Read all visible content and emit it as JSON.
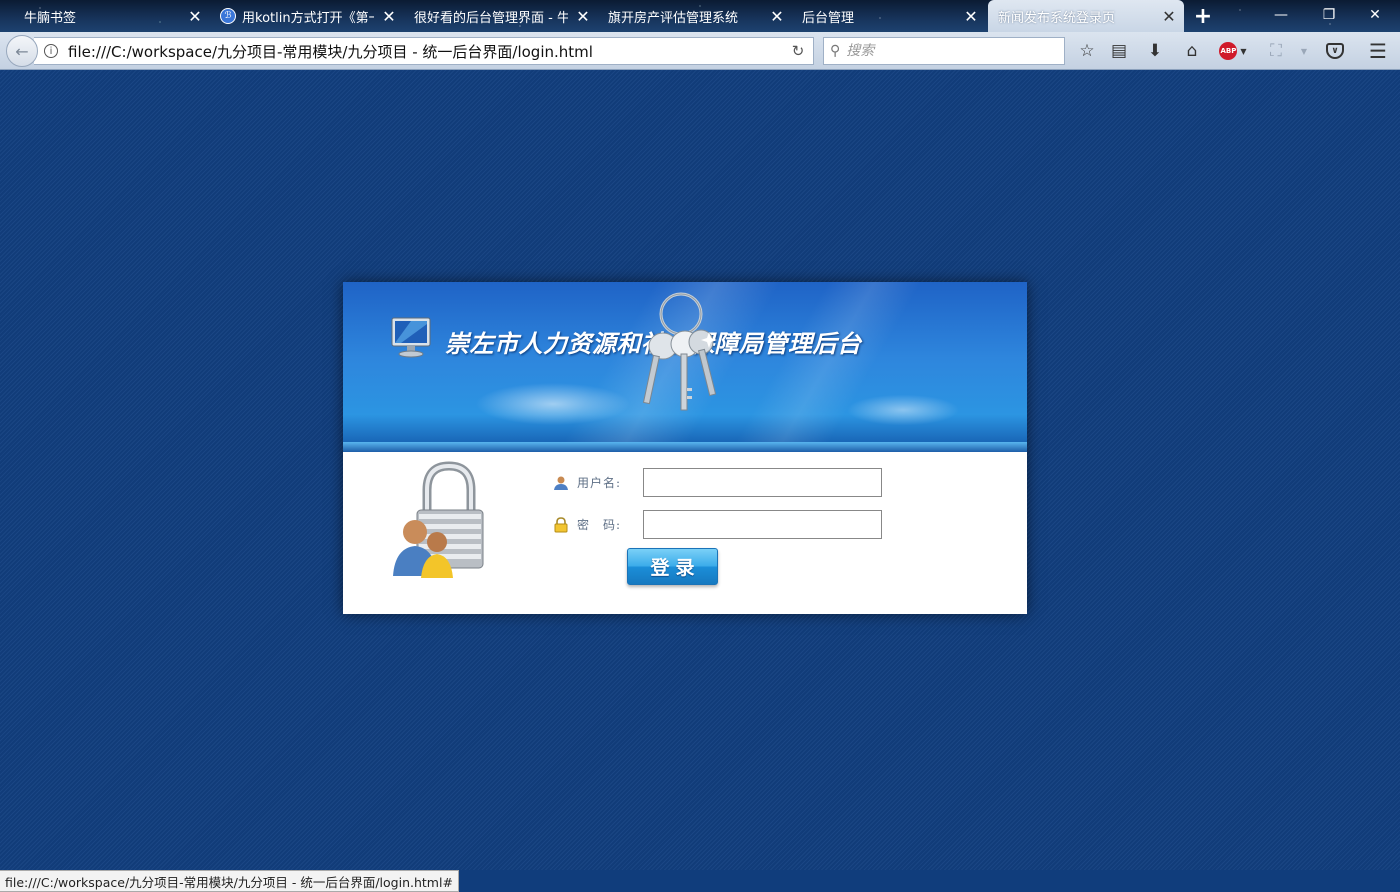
{
  "browser": {
    "tabs": [
      {
        "title": "牛腩书签",
        "has_favicon": false
      },
      {
        "title": "用kotlin方式打开《第一",
        "has_favicon": true
      },
      {
        "title": "很好看的后台管理界面 - 牛腩",
        "has_favicon": false
      },
      {
        "title": "旗开房产评估管理系统",
        "has_favicon": false
      },
      {
        "title": "后台管理",
        "has_favicon": false
      },
      {
        "title": "新闻发布系统登录页",
        "has_favicon": false,
        "active": true
      }
    ],
    "new_tab_label": "+",
    "window_controls": {
      "minimize": "—",
      "restore": "❐",
      "close": "✕"
    },
    "url": "file:///C:/workspace/九分项目-常用模块/九分项目 - 统一后台界面/login.html",
    "search_placeholder": "搜索",
    "toolbar_icons": [
      "star-icon",
      "reading-list-icon",
      "download-icon",
      "home-icon",
      "adblock-plus-icon",
      "crop-icon",
      "pocket-icon",
      "menu-icon"
    ],
    "abp_label": "ABP"
  },
  "login": {
    "system_title": "崇左市人力资源和社会保障局管理后台",
    "username_label": "用户名:",
    "password_label": "密　码:",
    "username_value": "",
    "password_value": "",
    "submit_label": "登录"
  },
  "status_bar": {
    "text": "file:///C:/workspace/九分项目-常用模块/九分项目 - 统一后台界面/login.html#"
  },
  "colors": {
    "page_background": "#123f7f",
    "banner_blue": "#2e86dd",
    "button_blue": "#1b8ed8",
    "label_gray": "#5e6f86"
  }
}
